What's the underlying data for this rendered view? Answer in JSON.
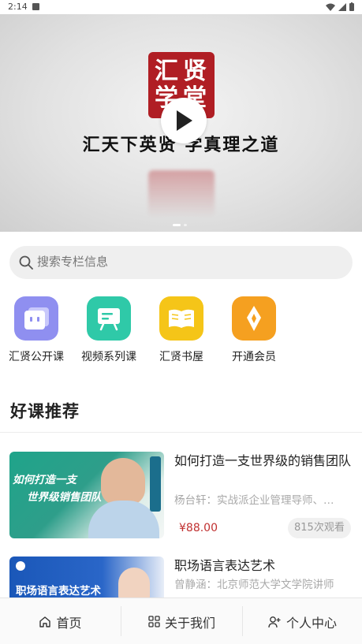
{
  "status": {
    "time": "2:14"
  },
  "banner": {
    "logo_chars": [
      "汇",
      "贤",
      "学",
      "堂"
    ],
    "slogan": "汇天下英贤 学真理之道",
    "slide_count": 2,
    "active_slide": 1
  },
  "search": {
    "placeholder": "搜索专栏信息"
  },
  "categories": [
    {
      "label": "汇贤公开课",
      "icon": "open-class-icon",
      "color": "#8f8ff0"
    },
    {
      "label": "视频系列课",
      "icon": "video-series-icon",
      "color": "#2fc9a8"
    },
    {
      "label": "汇贤书屋",
      "icon": "book-icon",
      "color": "#f5c518"
    },
    {
      "label": "开通会员",
      "icon": "membership-icon",
      "color": "#f5a020"
    }
  ],
  "section": {
    "title": "好课推荐"
  },
  "courses": [
    {
      "title": "如何打造一支世界级的销售团队",
      "subtitle": "杨台轩：实战派企业管理导师、…",
      "price": "¥88.00",
      "views": "815次观看",
      "thumb_text_1": "如何打造一支",
      "thumb_text_2": "世界级销售团队"
    },
    {
      "title": "职场语言表达艺术",
      "subtitle": "曾静涵：北京师范大学文学院讲师",
      "thumb_text_1": "职场语言表达艺术"
    }
  ],
  "tabbar": {
    "items": [
      {
        "label": "首页",
        "icon": "home-icon"
      },
      {
        "label": "关于我们",
        "icon": "grid-icon"
      },
      {
        "label": "个人中心",
        "icon": "user-add-icon"
      }
    ]
  }
}
